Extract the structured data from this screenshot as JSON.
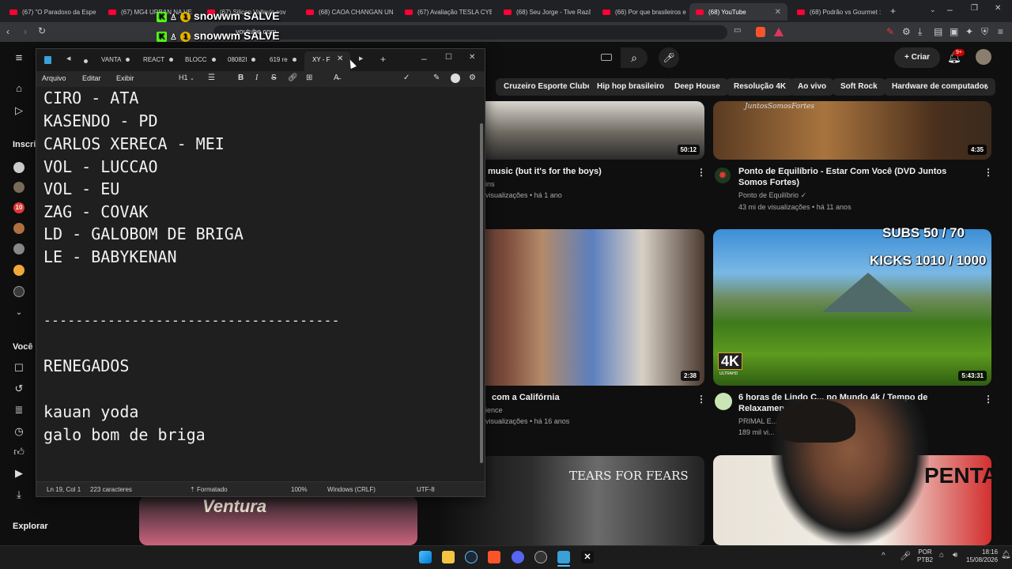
{
  "browser": {
    "tabs": [
      {
        "label": "(67) \"O Paradoxo da Espe",
        "x": 0
      },
      {
        "label": "(67) MG4 URBAN NA VE",
        "x": 1
      },
      {
        "label": "(67) Silicon Valley's cov",
        "x": 2
      },
      {
        "label": "(68) CAOA CHANGAN UN",
        "x": 3
      },
      {
        "label": "(67) Avaliação TESLA CYB",
        "x": 4
      },
      {
        "label": "(68) Seu Jorge - Tive Razã",
        "x": 5
      },
      {
        "label": "(66) Por que brasileiros e",
        "x": 6
      },
      {
        "label": "(68) YouTube",
        "x": 7
      },
      {
        "label": "(68) Podrão vs Gourmet :",
        "x": 8
      }
    ],
    "address": "youtube.com"
  },
  "overlay": {
    "line1": "snowwm SALVE",
    "line2": "snowwm SALVE",
    "kick_badge": "K",
    "coin": "1",
    "subs": "SUBS 50 / 70",
    "kicks": "KICKS 1010 / 1000"
  },
  "youtube": {
    "create_label": "Criar",
    "notif_count": "9+",
    "chips": [
      "Cruzeiro Esporte Clube",
      "Hip hop brasileiro",
      "Deep House",
      "Resolução 4K",
      "Ao vivo",
      "Soft Rock",
      "Hardware de computador"
    ],
    "nav": {
      "subscriptions_label": "Inscri",
      "you_label": "Você",
      "explore_label": "Explorar"
    },
    "videos": [
      {
        "title": "music (but it's for the boys)",
        "channel": "ins",
        "meta": "visualizações • há 1 ano",
        "duration": "50:12"
      },
      {
        "title": "Ponto de Equilíbrio - Estar Com Você (DVD Juntos Somos Fortes)",
        "channel": "Ponto de Equilíbrio",
        "meta": "43 mi de visualizações • há 11 anos",
        "duration": "4:35",
        "thumb_text": "JuntosSomosFortes"
      },
      {
        "title": "com a Califórnia",
        "channel": "ience",
        "meta": "visualizações • há 16 anos",
        "duration": "2:38"
      },
      {
        "title": "6 horas de Lindo C... no Mundo 4k / Tempo de Relaxamen...",
        "channel": "PRIMAL E...",
        "meta": "189 mil vi...",
        "duration": "5:43:31",
        "badge": "4K",
        "badge_sub": "ULTRAHD"
      },
      {
        "thumb_text": "TEARS FOR FEARS"
      },
      {
        "thumb_text": "PENTA"
      }
    ]
  },
  "notepad": {
    "tabs": [
      "VANTA",
      "REACT",
      "BLOCC",
      "08082I",
      "619 re",
      "XY - F"
    ],
    "menu": [
      "Arquivo",
      "Editar",
      "Exibir"
    ],
    "heading_btn": "H1",
    "lines": [
      "CIRO - ATA",
      "KASENDO - PD",
      "CARLOS XERECA - MEI",
      "VOL - LUCCAO",
      "VOL - EU",
      "ZAG - COVAK",
      "LD - GALOBOM DE BRIGA",
      "LE - BABYKENAN",
      "",
      "",
      "-------------------------------------",
      "",
      "RENEGADOS",
      "",
      "kauan yoda",
      "galo bom de briga"
    ],
    "status": {
      "position": "Ln 19, Col 1",
      "chars": "223 caracteres",
      "format": "Formatado",
      "zoom": "100%",
      "eol": "Windows (CRLF)",
      "encoding": "UTF-8"
    }
  },
  "taskbar": {
    "lang1": "POR",
    "lang2": "PTB2",
    "time": "18:16",
    "date": "15/08/2026"
  }
}
